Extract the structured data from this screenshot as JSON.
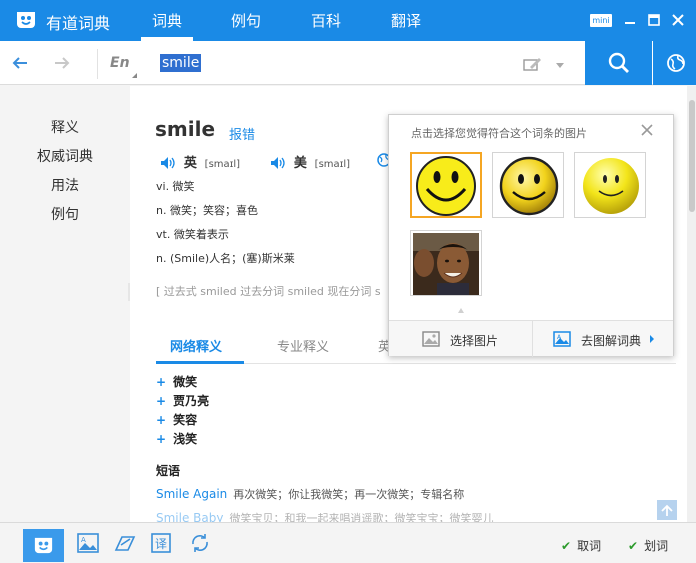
{
  "app": {
    "title": "有道词典",
    "tabs": [
      "词典",
      "例句",
      "百科",
      "翻译"
    ],
    "active_tab": "词典",
    "mini_label": "mini"
  },
  "search": {
    "lang": "En",
    "query": "smile"
  },
  "sidenav": {
    "items": [
      "释义",
      "权威词典",
      "用法",
      "例句"
    ]
  },
  "entry": {
    "word": "smile",
    "report_label": "报错",
    "pron": [
      {
        "label": "英",
        "ipa": "[smaɪl]"
      },
      {
        "label": "美",
        "ipa": "[smaɪl]"
      }
    ],
    "definitions": [
      "vi. 微笑",
      "n. 微笑；笑容；喜色",
      "vt. 微笑着表示",
      "n. (Smile)人名；(塞)斯米莱"
    ],
    "forms": "[ 过去式 smiled 过去分词 smiled 现在分词 s"
  },
  "tabs": {
    "items": [
      "网络释义",
      "专业释义",
      "英"
    ],
    "active": "网络释义"
  },
  "web_definitions": [
    "微笑",
    "贾乃亮",
    "笑容",
    "浅笑"
  ],
  "phrases": {
    "title": "短语",
    "items": [
      {
        "en": "Smile Again",
        "zh": "再次微笑；你让我微笑；再一次微笑；专辑名称"
      },
      {
        "en": "Smile Baby",
        "zh": "微笑宝贝；和我一起来唱逍遥歌；微笑宝宝；微笑婴儿"
      }
    ]
  },
  "popup": {
    "title": "点击选择您觉得符合这个词条的图片",
    "select_label": "选择图片",
    "visual_dict_label": "去图解词典"
  },
  "bottom": {
    "quick_lookup": "取词",
    "select_lookup": "划词"
  },
  "colors": {
    "brand_blue": "#1a8ae6",
    "selection_orange": "#f5a623",
    "check_green": "#2b9a2b"
  }
}
